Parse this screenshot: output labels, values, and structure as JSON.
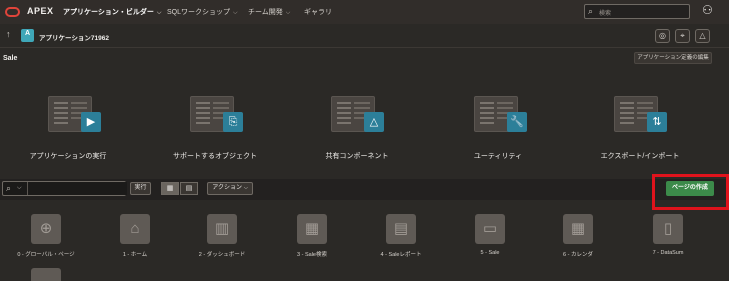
{
  "nav": {
    "brand": "APEX",
    "items": [
      {
        "label": "アプリケーション・ビルダー",
        "active": true
      },
      {
        "label": "SQLワークショップ",
        "active": false
      },
      {
        "label": "チーム開発",
        "active": false
      },
      {
        "label": "ギャラリ",
        "active": false
      }
    ],
    "search_placeholder": "検索",
    "caret": "⌵"
  },
  "app": {
    "name": "アプリケーション71962",
    "badge_letter": "A"
  },
  "page": {
    "title": "Sale",
    "edit_definition": "アプリケーション定義の編集"
  },
  "actions": [
    {
      "label": "アプリケーションの実行",
      "icon": "play-icon",
      "glyph": "▶"
    },
    {
      "label": "サポートするオブジェクト",
      "icon": "install-icon",
      "glyph": "⎘"
    },
    {
      "label": "共有コンポーネント",
      "icon": "shapes-icon",
      "glyph": "△"
    },
    {
      "label": "ユーティリティ",
      "icon": "wrench-icon",
      "glyph": "🔧"
    },
    {
      "label": "エクスポート/インポート",
      "icon": "export-import-icon",
      "glyph": "⇅"
    }
  ],
  "toolbar": {
    "run_label": "実行",
    "actions_label": "アクション",
    "create_page_label": "ページの作成"
  },
  "pages": [
    {
      "label": "0 - グローバル・ページ",
      "icon": "globe-icon",
      "glyph": "⊕"
    },
    {
      "label": "1 - ホーム",
      "icon": "home-icon",
      "glyph": "⌂"
    },
    {
      "label": "2 - ダッシュボード",
      "icon": "bar-chart-icon",
      "glyph": "▥"
    },
    {
      "label": "3 - Sale検索",
      "icon": "grid-icon",
      "glyph": "▦"
    },
    {
      "label": "4 - Saleレポート",
      "icon": "report-icon",
      "glyph": "▤"
    },
    {
      "label": "5 - Sale",
      "icon": "form-icon",
      "glyph": "▭"
    },
    {
      "label": "6 - カレンダ",
      "icon": "calendar-icon",
      "glyph": "▦"
    },
    {
      "label": "7 - DataSum",
      "icon": "data-icon",
      "glyph": "▯"
    }
  ]
}
